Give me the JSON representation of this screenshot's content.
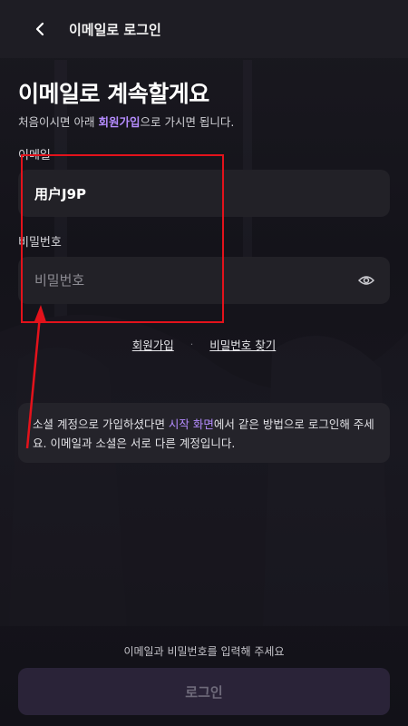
{
  "topbar": {
    "title": "이메일로 로그인"
  },
  "heading": "이메일로 계속할게요",
  "subtitle": {
    "prefix": "처음이시면 아래 ",
    "link": "회원가입",
    "suffix": "으로 가시면 됩니다."
  },
  "email": {
    "label": "이메일",
    "value": "用户J9P"
  },
  "password": {
    "label": "비밀번호",
    "placeholder": "비밀번호"
  },
  "links": {
    "signup": "회원가입",
    "separator": "·",
    "find_password": "비밀번호 찾기"
  },
  "notice": {
    "prefix": "소셜 계정으로 가입하셨다면 ",
    "link": "시작 화면",
    "suffix": "에서 같은 방법으로 로그인해 주세요. 이메일과 소셜은 서로 다른 계정입니다."
  },
  "footer": {
    "hint": "이메일과 비밀번호를 입력해 주세요",
    "login_label": "로그인"
  },
  "colors": {
    "accent": "#b58cff",
    "annotation": "#e3121b",
    "button_disabled": "#2a2338"
  },
  "icons": {
    "back": "chevron-left-icon",
    "eye": "eye-icon"
  }
}
